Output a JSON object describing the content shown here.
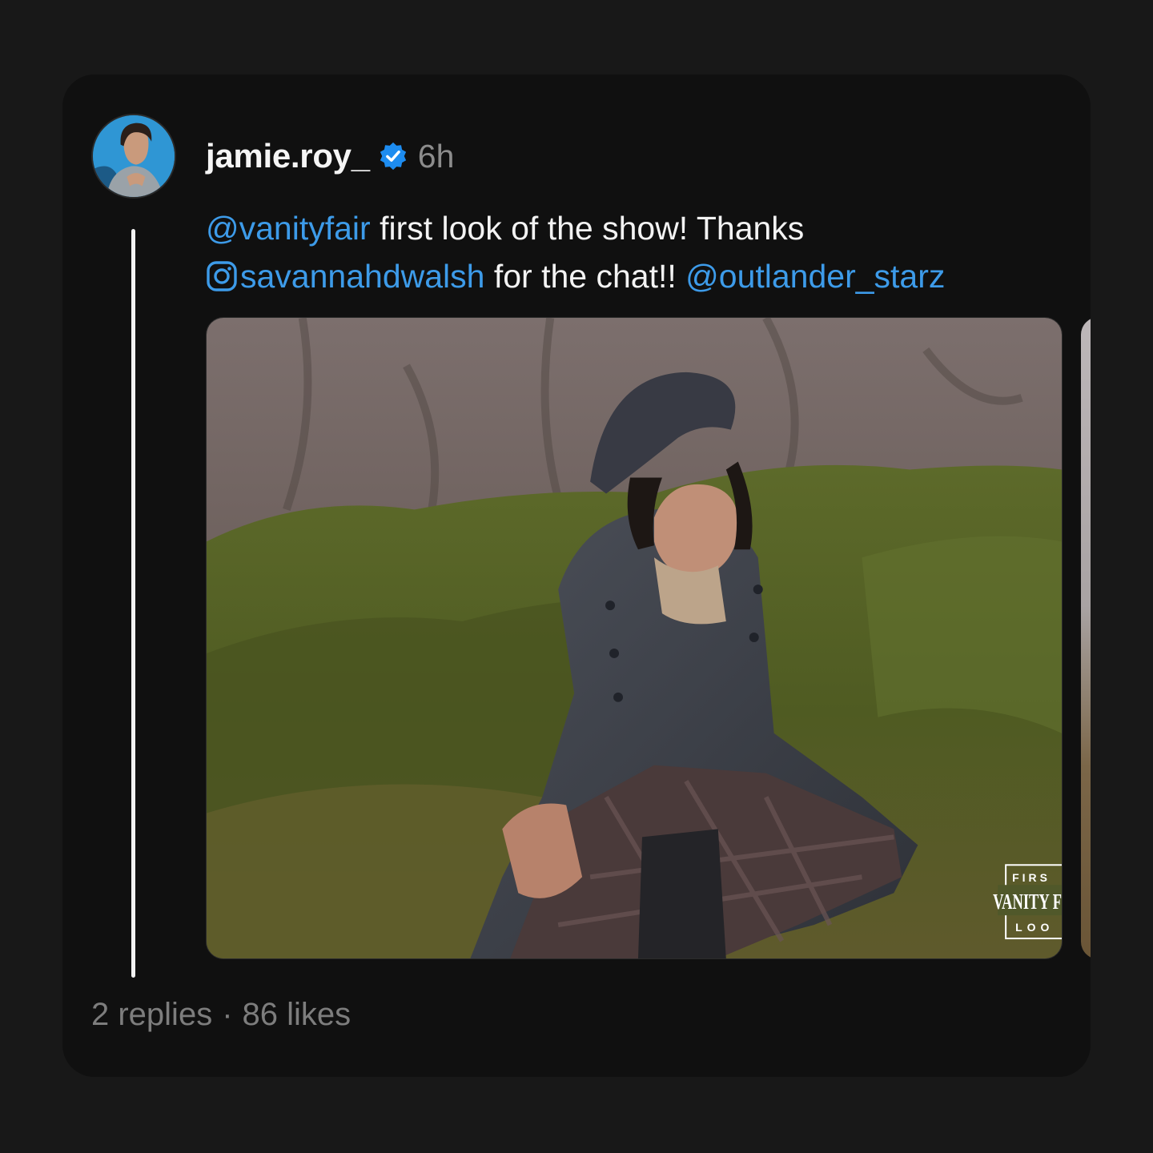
{
  "post": {
    "username": "jamie.roy_",
    "time": "6h",
    "caption": {
      "line1_mention": "@vanityfair",
      "line1_text": " first look of the show! Thanks",
      "line2_ig_handle": "savannahdwalsh",
      "line2_text": " for the chat!! ",
      "line2_mention": "@outlander_starz"
    },
    "image_overlay": {
      "line1": "FIRS",
      "line2": "VANITY F",
      "line3": "LOO"
    },
    "footer": {
      "replies": "2 replies",
      "separator": "·",
      "likes": "86 likes"
    }
  },
  "icons": {
    "verified": "verified-badge-icon",
    "instagram": "instagram-icon"
  },
  "colors": {
    "background": "#181818",
    "card": "#101010",
    "mention": "#3d9be9",
    "verified": "#1d8cf0",
    "muted": "#8c8c8c"
  }
}
